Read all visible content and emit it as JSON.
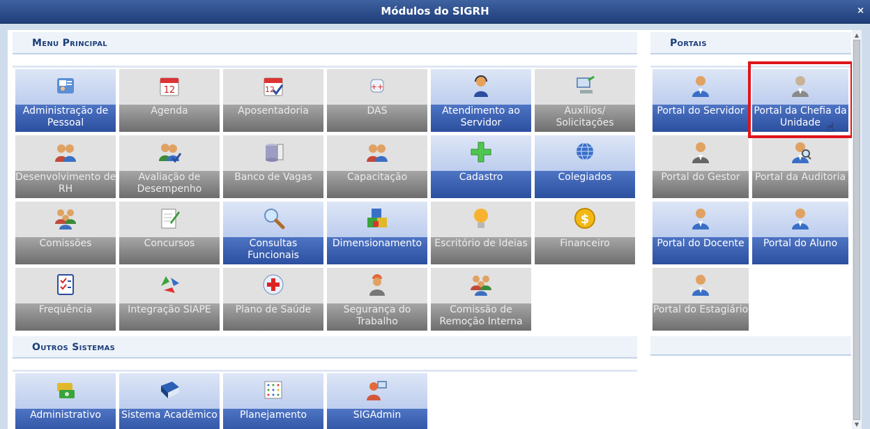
{
  "window": {
    "title": "Módulos do SIGRH",
    "close_label": "×"
  },
  "menu_principal": {
    "heading": "Menu Principal",
    "tiles": [
      {
        "label1": "Administração de",
        "label2": "Pessoal",
        "icon": "people-card-icon",
        "style": "blue"
      },
      {
        "label1": "Agenda",
        "label2": "",
        "icon": "calendar-icon",
        "style": "gray"
      },
      {
        "label1": "Aposentadoria",
        "label2": "",
        "icon": "calendar-check-icon",
        "style": "gray"
      },
      {
        "label1": "DAS",
        "label2": "",
        "icon": "medical-box-icon",
        "style": "gray"
      },
      {
        "label1": "Atendimento ao",
        "label2": "Servidor",
        "icon": "headset-icon",
        "style": "blue"
      },
      {
        "label1": "Auxílios/",
        "label2": "Solicitações",
        "icon": "computer-icon",
        "style": "gray"
      },
      {
        "label1": "Desenvolvimento de",
        "label2": "RH",
        "icon": "users-icon",
        "style": "gray"
      },
      {
        "label1": "Avaliação de",
        "label2": "Desempenho",
        "icon": "users-check-icon",
        "style": "gray"
      },
      {
        "label1": "Banco de Vagas",
        "label2": "",
        "icon": "database-icon",
        "style": "gray"
      },
      {
        "label1": "Capacitação",
        "label2": "",
        "icon": "users-icon",
        "style": "gray"
      },
      {
        "label1": "Cadastro",
        "label2": "",
        "icon": "plus-icon",
        "style": "blue"
      },
      {
        "label1": "Colegiados",
        "label2": "",
        "icon": "globe-icon",
        "style": "blue"
      },
      {
        "label1": "Comissões",
        "label2": "",
        "icon": "group-icon",
        "style": "gray"
      },
      {
        "label1": "Concursos",
        "label2": "",
        "icon": "edit-document-icon",
        "style": "gray"
      },
      {
        "label1": "Consultas",
        "label2": "Funcionais",
        "icon": "magnifier-icon",
        "style": "blue"
      },
      {
        "label1": "Dimensionamento",
        "label2": "",
        "icon": "blocks-icon",
        "style": "blue"
      },
      {
        "label1": "Escritório de Ideias",
        "label2": "",
        "icon": "lightbulb-icon",
        "style": "gray"
      },
      {
        "label1": "Financeiro",
        "label2": "",
        "icon": "dollar-coin-icon",
        "style": "gray"
      },
      {
        "label1": "Frequência",
        "label2": "",
        "icon": "checklist-icon",
        "style": "gray"
      },
      {
        "label1": "Integração SIAPE",
        "label2": "",
        "icon": "recycle-icon",
        "style": "gray"
      },
      {
        "label1": "Plano de Saúde",
        "label2": "",
        "icon": "medical-cross-icon",
        "style": "gray"
      },
      {
        "label1": "Segurança do",
        "label2": "Trabalho",
        "icon": "worker-icon",
        "style": "gray"
      },
      {
        "label1": "Comissão de",
        "label2": "Remoção Interna",
        "icon": "group-icon",
        "style": "gray"
      }
    ]
  },
  "outros_sistemas": {
    "heading": "Outros Sistemas",
    "tiles": [
      {
        "label1": "Administrativo",
        "label2": "",
        "icon": "money-icon",
        "style": "blue"
      },
      {
        "label1": "Sistema Acadêmico",
        "label2": "",
        "icon": "book-icon",
        "style": "blue"
      },
      {
        "label1": "Planejamento",
        "label2": "",
        "icon": "chart-grid-icon",
        "style": "blue"
      },
      {
        "label1": "SIGAdmin",
        "label2": "",
        "icon": "admin-user-icon",
        "style": "blue"
      }
    ]
  },
  "portais": {
    "heading": "Portais",
    "tiles": [
      {
        "label1": "Portal do Servidor",
        "label2": "",
        "icon": "user-blue-icon",
        "style": "blue"
      },
      {
        "label1": "Portal da Chefia da",
        "label2": "Unidade",
        "icon": "user-gray-icon",
        "style": "blue"
      },
      {
        "label1": "Portal do Gestor",
        "label2": "",
        "icon": "user-suit-icon",
        "style": "gray"
      },
      {
        "label1": "Portal da Auditoria",
        "label2": "",
        "icon": "user-search-icon",
        "style": "gray"
      },
      {
        "label1": "Portal do Docente",
        "label2": "",
        "icon": "user-blue-icon",
        "style": "blue"
      },
      {
        "label1": "Portal do Aluno",
        "label2": "",
        "icon": "user-blue-icon",
        "style": "blue"
      },
      {
        "label1": "Portal do Estagiário",
        "label2": "",
        "icon": "user-blue-icon",
        "style": "gray"
      }
    ]
  }
}
